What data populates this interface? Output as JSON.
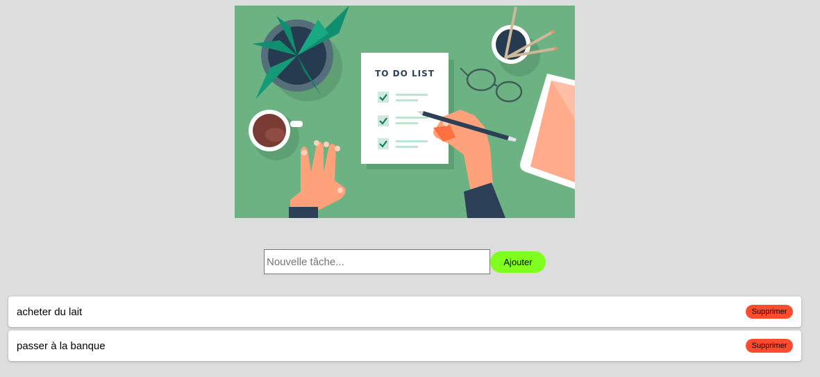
{
  "hero": {
    "illustration_text": "TO DO LIST",
    "background_color": "#6db282"
  },
  "form": {
    "placeholder": "Nouvelle tâche...",
    "value": "",
    "add_label": "Ajouter",
    "add_color": "#80ff1f"
  },
  "tasks": [
    {
      "text": "acheter du lait",
      "delete_label": "Supprimer"
    },
    {
      "text": "passer à la banque",
      "delete_label": "Supprimer"
    }
  ],
  "colors": {
    "page_background": "#dddddd",
    "delete_button": "#ff4c2e"
  }
}
